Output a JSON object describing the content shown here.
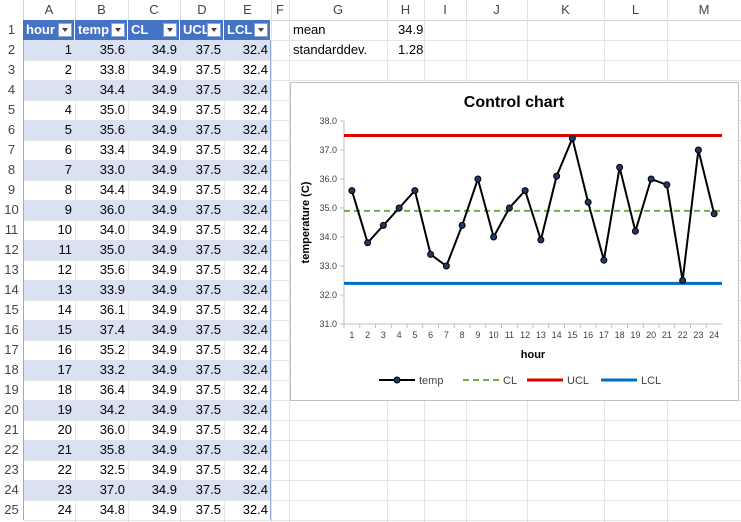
{
  "columns": [
    "A",
    "B",
    "C",
    "D",
    "E",
    "F",
    "G",
    "H",
    "I",
    "J",
    "K",
    "L",
    "M"
  ],
  "rows": [
    "1",
    "2",
    "3",
    "4",
    "5",
    "6",
    "7",
    "8",
    "9",
    "10",
    "11",
    "12",
    "13",
    "14",
    "15",
    "16",
    "17",
    "18",
    "19",
    "20",
    "21",
    "22",
    "23",
    "24",
    "25"
  ],
  "table": {
    "headers": [
      "hour",
      "temp",
      "CL",
      "UCL",
      "LCL"
    ],
    "rows": [
      [
        "1",
        "35.6",
        "34.9",
        "37.5",
        "32.4"
      ],
      [
        "2",
        "33.8",
        "34.9",
        "37.5",
        "32.4"
      ],
      [
        "3",
        "34.4",
        "34.9",
        "37.5",
        "32.4"
      ],
      [
        "4",
        "35.0",
        "34.9",
        "37.5",
        "32.4"
      ],
      [
        "5",
        "35.6",
        "34.9",
        "37.5",
        "32.4"
      ],
      [
        "6",
        "33.4",
        "34.9",
        "37.5",
        "32.4"
      ],
      [
        "7",
        "33.0",
        "34.9",
        "37.5",
        "32.4"
      ],
      [
        "8",
        "34.4",
        "34.9",
        "37.5",
        "32.4"
      ],
      [
        "9",
        "36.0",
        "34.9",
        "37.5",
        "32.4"
      ],
      [
        "10",
        "34.0",
        "34.9",
        "37.5",
        "32.4"
      ],
      [
        "11",
        "35.0",
        "34.9",
        "37.5",
        "32.4"
      ],
      [
        "12",
        "35.6",
        "34.9",
        "37.5",
        "32.4"
      ],
      [
        "13",
        "33.9",
        "34.9",
        "37.5",
        "32.4"
      ],
      [
        "14",
        "36.1",
        "34.9",
        "37.5",
        "32.4"
      ],
      [
        "15",
        "37.4",
        "34.9",
        "37.5",
        "32.4"
      ],
      [
        "16",
        "35.2",
        "34.9",
        "37.5",
        "32.4"
      ],
      [
        "17",
        "33.2",
        "34.9",
        "37.5",
        "32.4"
      ],
      [
        "18",
        "36.4",
        "34.9",
        "37.5",
        "32.4"
      ],
      [
        "19",
        "34.2",
        "34.9",
        "37.5",
        "32.4"
      ],
      [
        "20",
        "36.0",
        "34.9",
        "37.5",
        "32.4"
      ],
      [
        "21",
        "35.8",
        "34.9",
        "37.5",
        "32.4"
      ],
      [
        "22",
        "32.5",
        "34.9",
        "37.5",
        "32.4"
      ],
      [
        "23",
        "37.0",
        "34.9",
        "37.5",
        "32.4"
      ],
      [
        "24",
        "34.8",
        "34.9",
        "37.5",
        "32.4"
      ]
    ]
  },
  "stats": {
    "mean_label": "mean",
    "mean_value": "34.9",
    "std_label": "standarddev.",
    "std_value": "1.28"
  },
  "colors": {
    "table_header": "#4472c4",
    "band": "#d9e1f2",
    "temp": "#000000",
    "cl": "#70ad47",
    "ucl": "#e00000",
    "lcl": "#0070c0"
  },
  "chart_data": {
    "type": "line",
    "title": "Control chart",
    "xlabel": "hour",
    "ylabel": "temperature (C)",
    "x": [
      1,
      2,
      3,
      4,
      5,
      6,
      7,
      8,
      9,
      10,
      11,
      12,
      13,
      14,
      15,
      16,
      17,
      18,
      19,
      20,
      21,
      22,
      23,
      24
    ],
    "ylim": [
      31.0,
      38.0
    ],
    "yticks": [
      "31.0",
      "32.0",
      "33.0",
      "34.0",
      "35.0",
      "36.0",
      "37.0",
      "38.0"
    ],
    "series": [
      {
        "name": "temp",
        "values": [
          35.6,
          33.8,
          34.4,
          35.0,
          35.6,
          33.4,
          33.0,
          34.4,
          36.0,
          34.0,
          35.0,
          35.6,
          33.9,
          36.1,
          37.4,
          35.2,
          33.2,
          36.4,
          34.2,
          36.0,
          35.8,
          32.5,
          37.0,
          34.8
        ]
      },
      {
        "name": "CL",
        "values": [
          34.9,
          34.9,
          34.9,
          34.9,
          34.9,
          34.9,
          34.9,
          34.9,
          34.9,
          34.9,
          34.9,
          34.9,
          34.9,
          34.9,
          34.9,
          34.9,
          34.9,
          34.9,
          34.9,
          34.9,
          34.9,
          34.9,
          34.9,
          34.9
        ]
      },
      {
        "name": "UCL",
        "values": [
          37.5,
          37.5,
          37.5,
          37.5,
          37.5,
          37.5,
          37.5,
          37.5,
          37.5,
          37.5,
          37.5,
          37.5,
          37.5,
          37.5,
          37.5,
          37.5,
          37.5,
          37.5,
          37.5,
          37.5,
          37.5,
          37.5,
          37.5,
          37.5
        ]
      },
      {
        "name": "LCL",
        "values": [
          32.4,
          32.4,
          32.4,
          32.4,
          32.4,
          32.4,
          32.4,
          32.4,
          32.4,
          32.4,
          32.4,
          32.4,
          32.4,
          32.4,
          32.4,
          32.4,
          32.4,
          32.4,
          32.4,
          32.4,
          32.4,
          32.4,
          32.4,
          32.4
        ]
      }
    ],
    "legend": "bottom",
    "grid": false
  }
}
